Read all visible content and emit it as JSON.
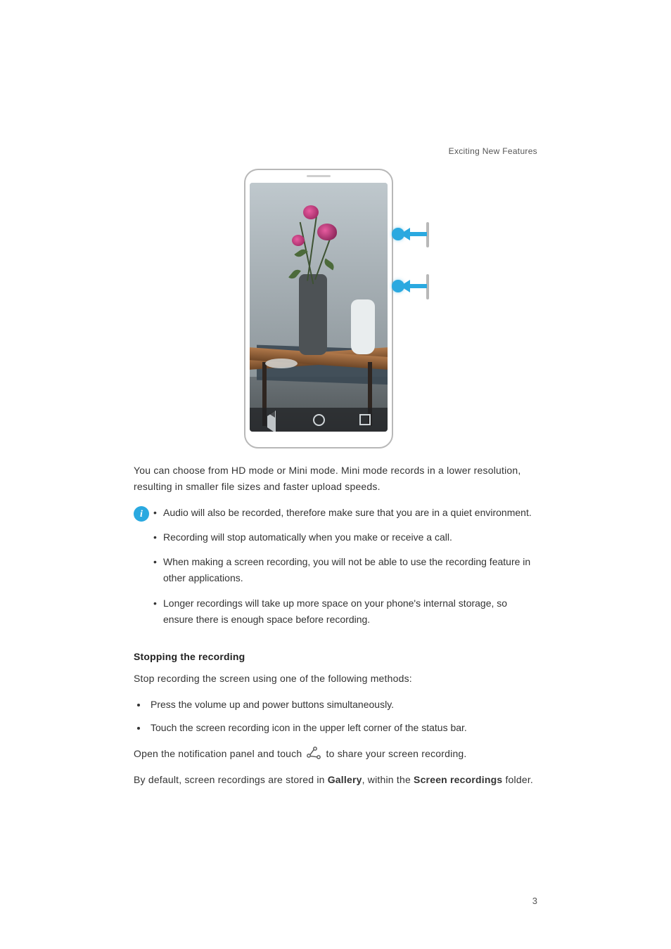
{
  "header": {
    "section_title": "Exciting New Features"
  },
  "body": {
    "mode_paragraph": "You can choose from HD mode or Mini mode. Mini mode records in a lower resolution, resulting in smaller file sizes and faster upload speeds.",
    "info_bullets": [
      "Audio will also be recorded, therefore make sure that you are in a quiet environment.",
      "Recording will stop automatically when you make or receive a call.",
      "When making a screen recording, you will not be able to use the recording feature in other applications.",
      "Longer recordings will take up more space on your phone's internal storage, so ensure there is enough space before recording."
    ],
    "stop_heading": "Stopping the recording",
    "stop_intro": "Stop recording the screen using one of the following methods:",
    "stop_bullets": [
      "Press the volume up and power buttons simultaneously.",
      "Touch the screen recording icon in the upper left corner of the status bar."
    ],
    "share_pre": "Open the notification panel and touch ",
    "share_post": " to share your screen recording.",
    "storage_pre": "By default, screen recordings are stored in ",
    "storage_app": "Gallery",
    "storage_mid": ", within the ",
    "storage_folder": "Screen recordings",
    "storage_post": " folder."
  },
  "footer": {
    "page_number": "3"
  }
}
